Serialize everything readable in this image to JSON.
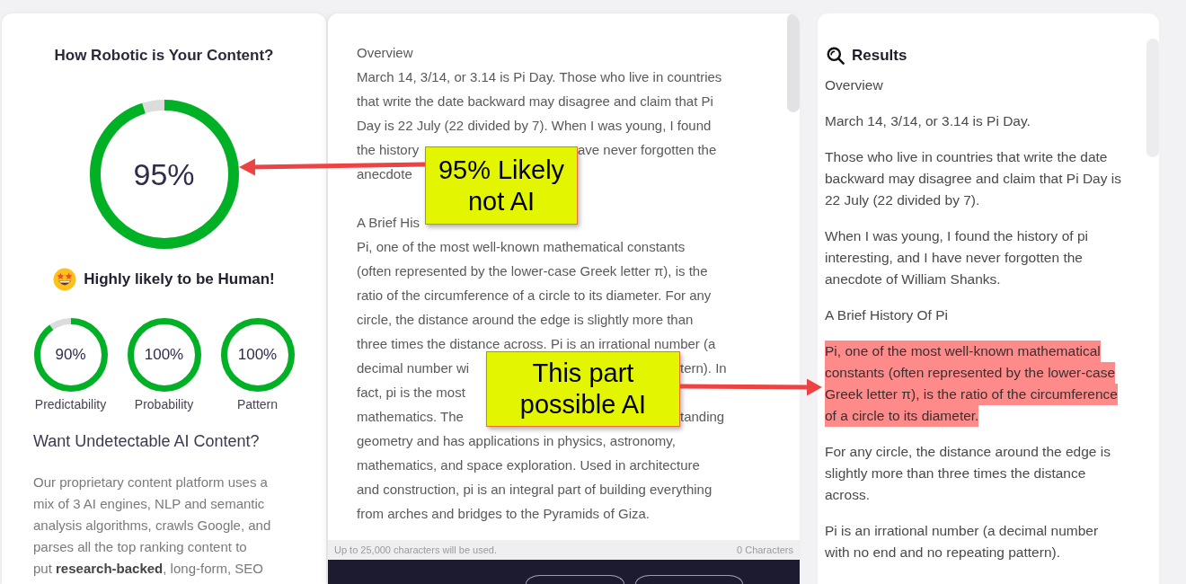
{
  "score_panel": {
    "title": "How Robotic is Your Content?",
    "score": {
      "value": "95%",
      "level": 0.95
    },
    "verdict": "Highly likely to be Human!",
    "metrics": [
      {
        "value": "90%",
        "level": 0.9,
        "label": "Predictability"
      },
      {
        "value": "100%",
        "level": 1,
        "label": "Probability"
      },
      {
        "value": "100%",
        "level": 1,
        "label": "Pattern"
      }
    ],
    "promo": {
      "heading": "Want Undetectable AI Content?",
      "lines": [
        "Our proprietary content platform uses a",
        "mix of 3 AI engines, NLP and semantic",
        "analysis algorithms, crawls Google, and",
        "parses all the top ranking content to",
        "put **research-backed**, long-form, SEO"
      ]
    }
  },
  "editor": {
    "sections": [
      {
        "lines": [
          [
            "Overview"
          ],
          [
            "March 14, 3/14, or 3.14 is Pi Day. Those who live in countries"
          ],
          [
            "that write the date backward may disagree and claim that Pi"
          ],
          [
            "Day is 22 July (22 divided by 7). When I was young, I found"
          ],
          [
            "the history",
            "ave never forgotten the"
          ],
          [
            "anecdote"
          ]
        ]
      },
      {
        "lines": [
          [
            "A Brief His"
          ],
          [
            "Pi, one of the most well-known mathematical constants"
          ],
          [
            "(often represented by the lower-case Greek letter π), is the"
          ],
          [
            "ratio of the circumference of a circle to its diameter. For any"
          ],
          [
            "circle, the distance around the edge is slightly more than"
          ],
          [
            "three times the distance across. Pi is an irrational number (a"
          ],
          [
            "decimal number wi",
            "tern). In"
          ],
          [
            "fact, pi is the most"
          ],
          [
            "mathematics. The",
            "tanding"
          ],
          [
            "geometry and has applications in physics, astronomy,"
          ],
          [
            "mathematics, and space exploration. Used in architecture"
          ],
          [
            "and construction, pi is an integral part of building everything"
          ],
          [
            "from arches and bridges to the Pyramids of Giza."
          ]
        ]
      }
    ],
    "limit_note": "Up to 25,000 characters will be used.",
    "char_count": "0 Characters"
  },
  "results": {
    "title": "Results",
    "paragraphs": [
      {
        "lines": [
          "Overview"
        ],
        "flagged": false
      },
      {
        "lines": [
          "March 14, 3/14, or 3.14 is Pi Day."
        ],
        "flagged": false
      },
      {
        "lines": [
          "Those who live in countries that write the date",
          "backward may disagree and claim that Pi Day is",
          "22 July (22 divided by 7)."
        ],
        "flagged": false
      },
      {
        "lines": [
          "When I was young, I found the history of pi",
          "interesting, and I have never forgotten the",
          "anecdote of William Shanks."
        ],
        "flagged": false
      },
      {
        "lines": [
          "A Brief History Of Pi"
        ],
        "flagged": false
      },
      {
        "lines": [
          "Pi, one of the most well-known mathematical",
          "constants (often represented by the lower-case",
          "Greek letter π), is the ratio of the circumference",
          "of a circle to its diameter."
        ],
        "flagged": true
      },
      {
        "lines": [
          "For any circle, the distance around the edge is",
          "slightly more than three times the distance",
          "across."
        ],
        "flagged": false
      },
      {
        "lines": [
          "Pi is an irrational number (a decimal number",
          "with no end and no repeating pattern)."
        ],
        "flagged": false
      }
    ]
  },
  "annotations": [
    {
      "text": "95% Likely not AI"
    },
    {
      "text": "This part possible AI"
    }
  ]
}
